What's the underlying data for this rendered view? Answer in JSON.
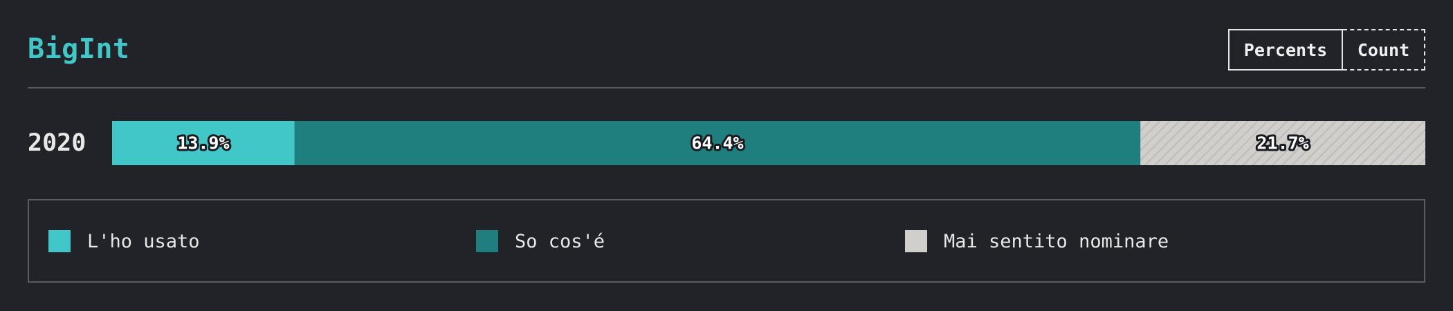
{
  "header": {
    "title": "BigInt",
    "toggle": {
      "percents_label": "Percents",
      "count_label": "Count",
      "selected": "Percents"
    }
  },
  "colors": {
    "accent": "#41c7c7",
    "used": "#41c7c7",
    "know": "#1f7f7e",
    "never": "#d0cfcc",
    "background": "#222329"
  },
  "chart_data": {
    "type": "bar",
    "orientation": "horizontal",
    "stacked": true,
    "title": "BigInt",
    "categories": [
      "2020"
    ],
    "series": [
      {
        "name": "L'ho usato",
        "values": [
          13.9
        ],
        "label": "13.9%",
        "color": "#41c7c7"
      },
      {
        "name": "So cos'é",
        "values": [
          64.4
        ],
        "label": "64.4%",
        "color": "#1f7f7e"
      },
      {
        "name": "Mai sentito nominare",
        "values": [
          21.7
        ],
        "label": "21.7%",
        "color": "#d0cfcc",
        "hatched": true
      }
    ],
    "xlim": [
      0,
      100
    ],
    "unit": "%",
    "legend_position": "bottom",
    "grid": false
  },
  "legend": [
    {
      "label": "L'ho usato",
      "color": "#41c7c7"
    },
    {
      "label": "So cos'é",
      "color": "#1f7f7e"
    },
    {
      "label": "Mai sentito nominare",
      "color": "#d0cfcc"
    }
  ]
}
